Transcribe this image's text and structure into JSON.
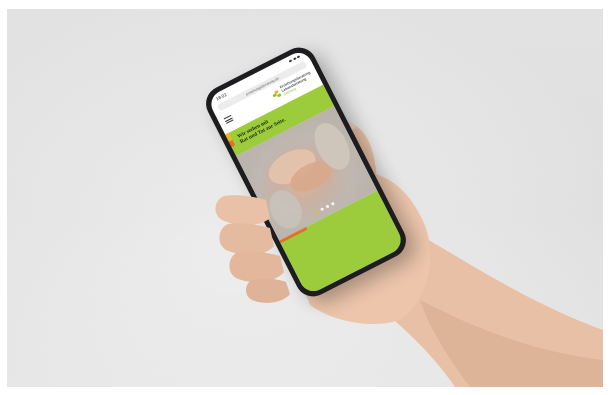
{
  "phone": {
    "status_time": "18:02",
    "url": "erziehungsberatung.de",
    "logo": {
      "line1": "Erziehungsberatung",
      "line2": "Lebensberatung",
      "line3": "Salzburg"
    },
    "hero_text_line1": "Wir stehen mit",
    "hero_text_line2": "Rat und Tat zur Seite.",
    "carousel_slides": 4,
    "carousel_active": 0
  },
  "colors": {
    "brand_green": "#9ccb3b",
    "accent_yellow": "#f4b321",
    "accent_orange": "#e0712b",
    "phone_frame": "#1d1d1f",
    "background": "#e8e8e8",
    "skin": "#e8c0a8"
  }
}
